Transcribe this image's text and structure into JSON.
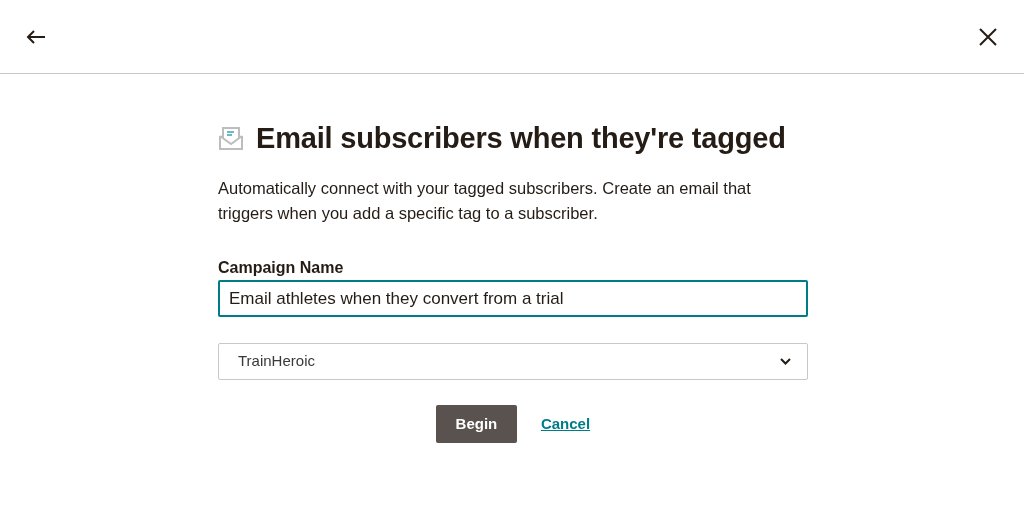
{
  "title": "Email subscribers when they're tagged",
  "description": "Automatically connect with your tagged subscribers. Create an email that triggers when you add a specific tag to a subscriber.",
  "campaign_name": {
    "label": "Campaign Name",
    "value": "Email athletes when they convert from a trial",
    "focused": true
  },
  "audience_select": {
    "value": "TrainHeroic"
  },
  "buttons": {
    "primary": "Begin",
    "secondary": "Cancel"
  }
}
